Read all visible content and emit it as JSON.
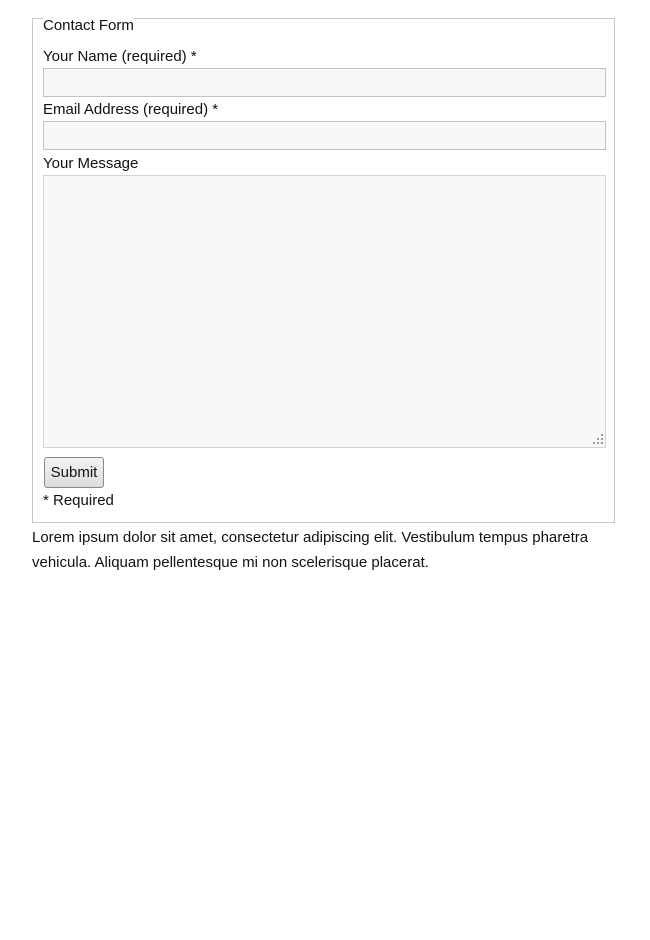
{
  "form": {
    "legend": "Contact Form",
    "name_label": "Your Name (required) *",
    "name_value": "",
    "email_label": "Email Address (required) *",
    "email_value": "",
    "message_label": "Your Message",
    "message_value": "",
    "submit_label": "Submit",
    "required_note": "* Required"
  },
  "content": {
    "paragraph": "Lorem ipsum dolor sit amet, consectetur adipiscing elit. Vestibulum tempus pharetra vehicula. Aliquam pellentesque mi non scelerisque placerat."
  }
}
